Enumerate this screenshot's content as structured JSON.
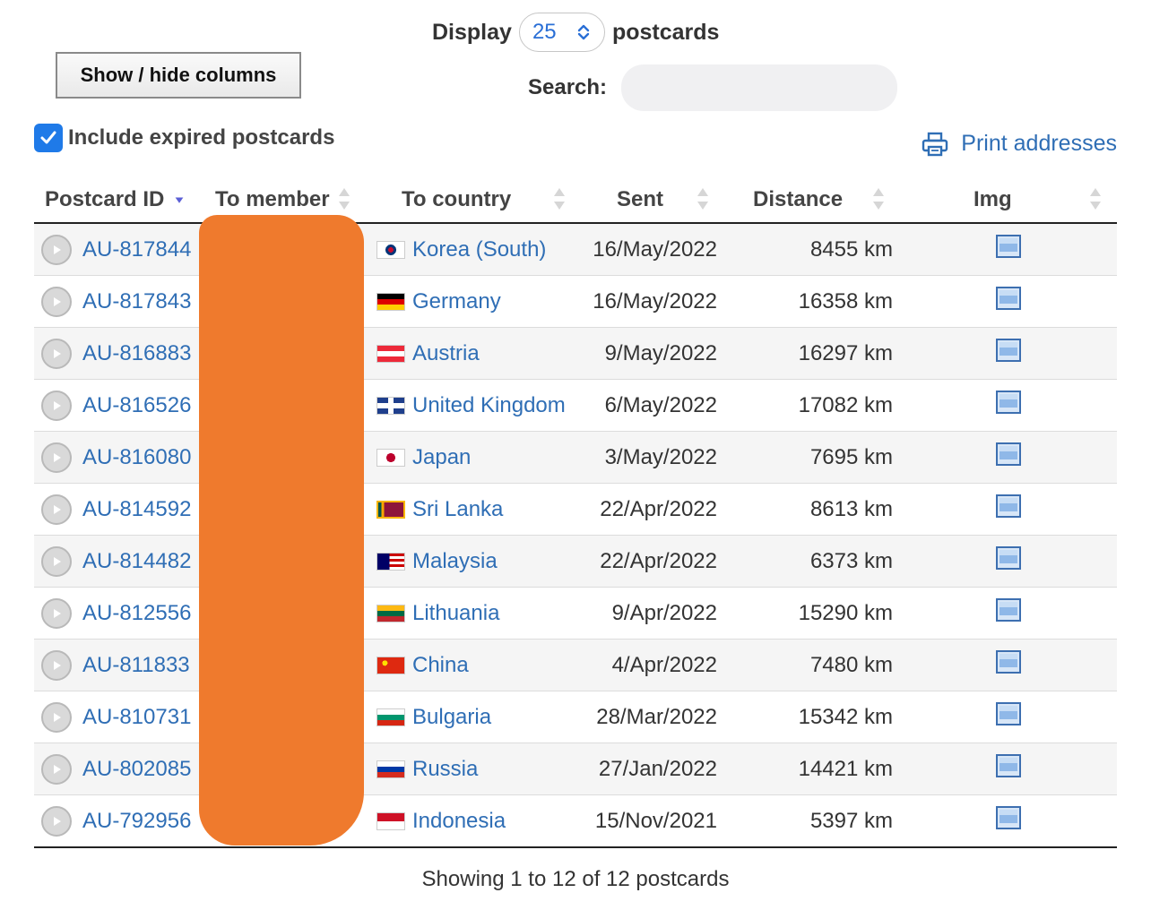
{
  "controls": {
    "display_label": "Display",
    "display_value": "25",
    "display_suffix": "postcards",
    "show_hide_label": "Show / hide columns",
    "search_label": "Search:",
    "search_value": "",
    "include_expired_label": "Include expired postcards",
    "include_expired_checked": true,
    "print_label": "Print addresses"
  },
  "table": {
    "headers": [
      "Postcard ID",
      "To member",
      "To country",
      "Sent",
      "Distance",
      "Img"
    ],
    "rows": [
      {
        "id": "AU-817844",
        "country": "Korea (South)",
        "flag": "korea",
        "sent": "16/May/2022",
        "distance": "8455 km"
      },
      {
        "id": "AU-817843",
        "country": "Germany",
        "flag": "germany",
        "sent": "16/May/2022",
        "distance": "16358 km"
      },
      {
        "id": "AU-816883",
        "country": "Austria",
        "flag": "austria",
        "sent": "9/May/2022",
        "distance": "16297 km"
      },
      {
        "id": "AU-816526",
        "country": "United Kingdom",
        "flag": "uk",
        "sent": "6/May/2022",
        "distance": "17082 km"
      },
      {
        "id": "AU-816080",
        "country": "Japan",
        "flag": "japan",
        "sent": "3/May/2022",
        "distance": "7695 km"
      },
      {
        "id": "AU-814592",
        "country": "Sri Lanka",
        "flag": "srilanka",
        "sent": "22/Apr/2022",
        "distance": "8613 km"
      },
      {
        "id": "AU-814482",
        "country": "Malaysia",
        "flag": "malaysia",
        "sent": "22/Apr/2022",
        "distance": "6373 km"
      },
      {
        "id": "AU-812556",
        "country": "Lithuania",
        "flag": "lithuania",
        "sent": "9/Apr/2022",
        "distance": "15290 km"
      },
      {
        "id": "AU-811833",
        "country": "China",
        "flag": "china",
        "sent": "4/Apr/2022",
        "distance": "7480 km"
      },
      {
        "id": "AU-810731",
        "country": "Bulgaria",
        "flag": "bulgaria",
        "sent": "28/Mar/2022",
        "distance": "15342 km"
      },
      {
        "id": "AU-802085",
        "country": "Russia",
        "flag": "russia",
        "sent": "27/Jan/2022",
        "distance": "14421 km"
      },
      {
        "id": "AU-792956",
        "country": "Indonesia",
        "flag": "indonesia",
        "sent": "15/Nov/2021",
        "distance": "5397 km"
      }
    ]
  },
  "footer": {
    "summary": "Showing 1 to 12 of 12 postcards"
  },
  "colors": {
    "link": "#2f6eb5",
    "checkbox": "#1f7ae8",
    "redaction": "#ef7a2d"
  }
}
